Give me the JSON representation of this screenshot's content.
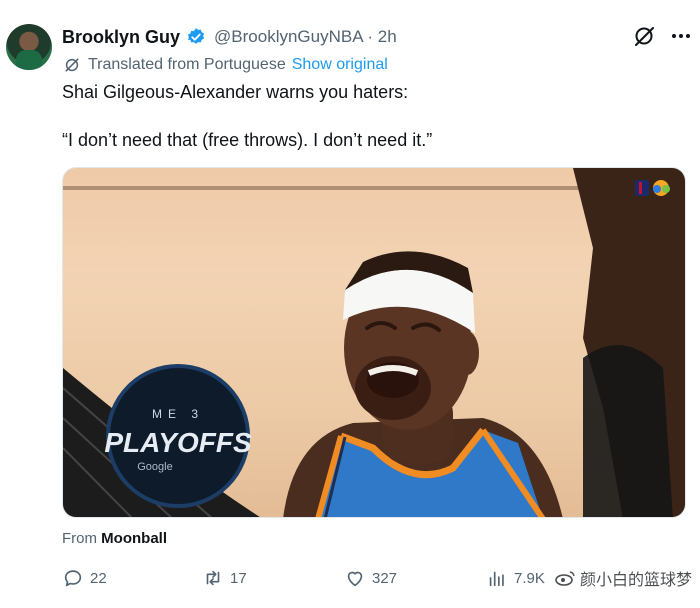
{
  "author": {
    "name": "Brooklyn Guy",
    "handle": "@BrooklynGuyNBA",
    "separator": "·",
    "time": "2h"
  },
  "translation": {
    "label": "Translated from Portuguese",
    "show_original": "Show original"
  },
  "tweet": {
    "line1": "Shai Gilgeous-Alexander warns you haters:",
    "line2": "“I don’t need that (free throws). I don’t need it.”"
  },
  "media": {
    "overlay_text": "PLAYOFFS",
    "overlay_sub": "Google",
    "overlay_top": "ME 3"
  },
  "source": {
    "prefix": "From",
    "name": "Moonball"
  },
  "actions": {
    "replies": "22",
    "reposts": "17",
    "likes": "327",
    "views": "7.9K"
  },
  "watermark": "颜小白的篮球梦",
  "colors": {
    "verified": "#1d9bf0",
    "link": "#1d9bf0",
    "secondary_text": "#536471"
  },
  "icons": [
    "avatar",
    "verified-badge-icon",
    "grok-icon",
    "more-icon",
    "translate-icon",
    "reply-icon",
    "repost-icon",
    "like-icon",
    "views-icon",
    "weibo-icon"
  ]
}
